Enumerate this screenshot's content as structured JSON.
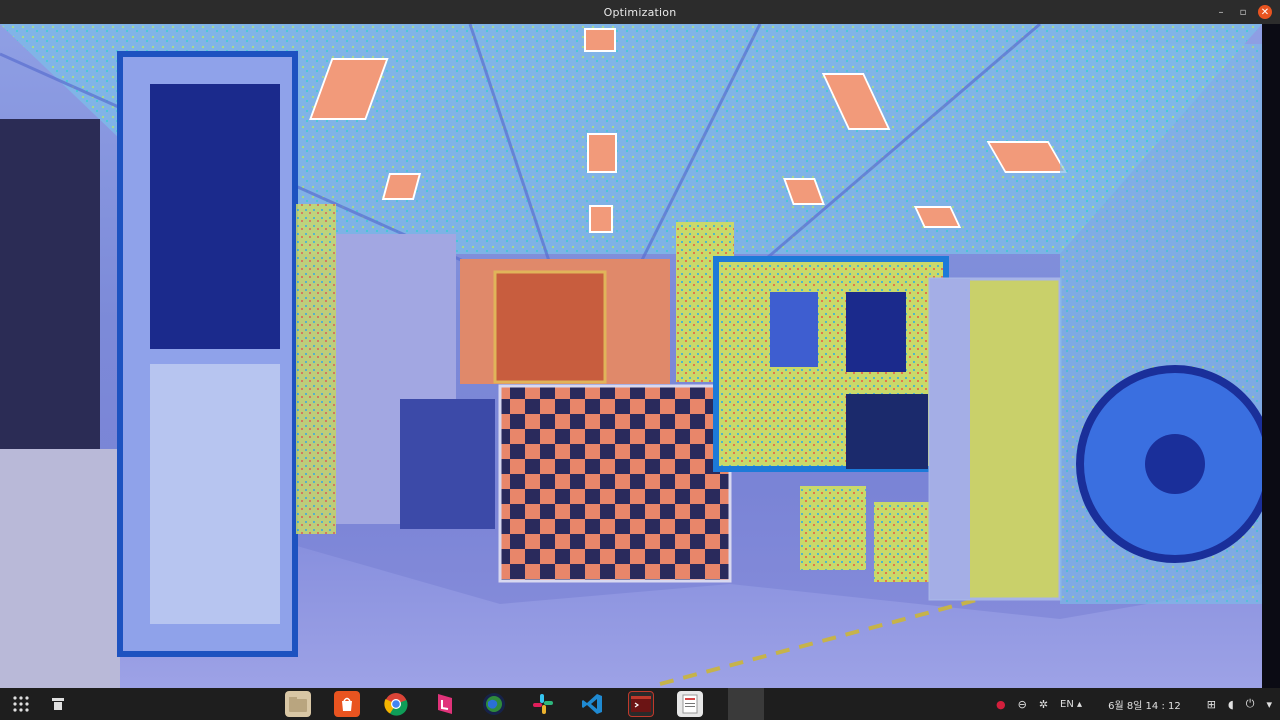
{
  "window": {
    "title": "Optimization"
  },
  "titlebar": {
    "minimize_icon": "minimize-icon",
    "maximize_icon": "maximize-icon",
    "close_icon": "close-icon"
  },
  "viewer": {
    "content": "colored-point-cloud-overlay-on-lab-camera-image"
  },
  "taskbar": {
    "launcher_icon": "apps-grid-icon",
    "switcher_icon": "window-switcher-icon",
    "dock": [
      {
        "name": "files-icon",
        "color": "#d9c7a5"
      },
      {
        "name": "app-store-icon",
        "color": "#e95420"
      },
      {
        "name": "chrome-icon",
        "color": "#4285f4"
      },
      {
        "name": "pink-app-icon",
        "color": "#e0337a"
      },
      {
        "name": "globe-app-icon",
        "color": "#2f8a3c"
      },
      {
        "name": "slack-icon",
        "color": "#ffffff"
      },
      {
        "name": "vscode-icon",
        "color": "#1f8ad2"
      },
      {
        "name": "terminal-icon",
        "color": "#c0392b"
      },
      {
        "name": "document-viewer-icon",
        "color": "#e8e8e8"
      }
    ],
    "tray": {
      "record_icon": "record-icon",
      "minus_icon": "minus-circle-icon",
      "network_icon": "network-hub-icon",
      "input_language": "EN",
      "datetime": "6월 8일 14 : 12",
      "lan_icon": "lan-icon",
      "volume_icon": "volume-icon",
      "power_icon": "power-icon"
    }
  }
}
